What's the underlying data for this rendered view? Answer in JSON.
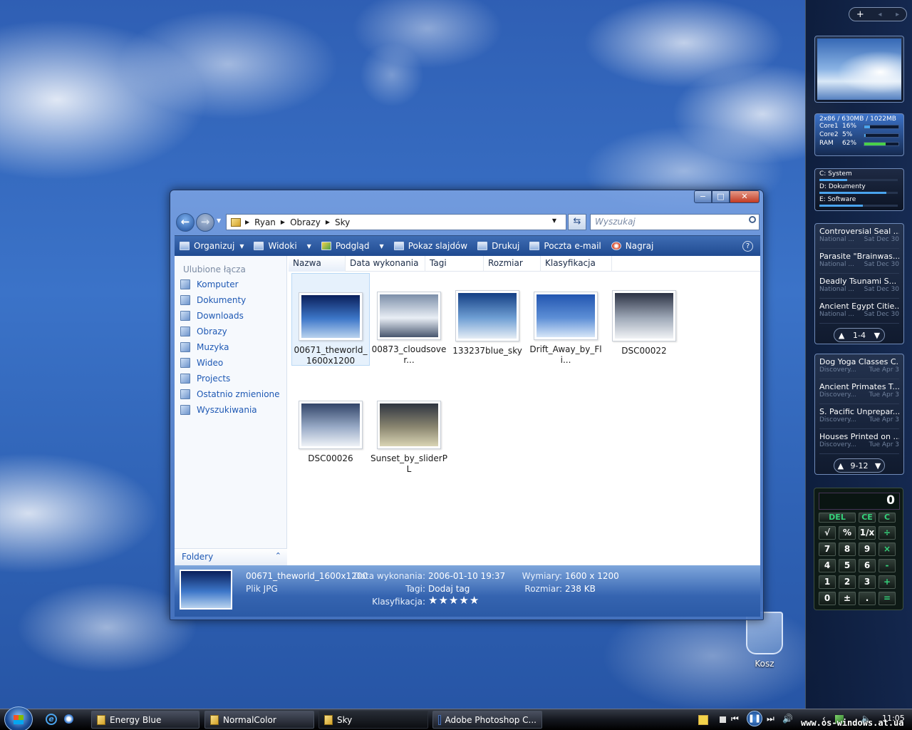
{
  "window": {
    "minimize": "−",
    "maximize": "□",
    "close": "✕"
  },
  "address": {
    "path": [
      "Ryan",
      "Obrazy",
      "Sky"
    ],
    "search_placeholder": "Wyszukaj"
  },
  "toolbar": [
    "Organizuj",
    "Widoki",
    "Podgląd",
    "Pokaz slajdów",
    "Drukuj",
    "Poczta e-mail",
    "Nagraj"
  ],
  "toolbar_help": "?",
  "nav": {
    "header": "Ulubione łącza",
    "items": [
      "Komputer",
      "Dokumenty",
      "Downloads",
      "Obrazy",
      "Muzyka",
      "Wideo",
      "Projects",
      "Ostatnio zmienione",
      "Wyszukiwania"
    ],
    "folders": "Foldery"
  },
  "columns": [
    "Nazwa",
    "Data wykonania",
    "Tagi",
    "Rozmiar",
    "Klasyfikacja"
  ],
  "files": [
    {
      "name": "00671_theworld_1600x1200",
      "colors": [
        "#0a1f5a",
        "#3d77c9",
        "#b9d3ee"
      ]
    },
    {
      "name": "00873_cloudsover...",
      "colors": [
        "#7c8fa9",
        "#e9eef5",
        "#47566f"
      ]
    },
    {
      "name": "133237blue_sky",
      "colors": [
        "#143f84",
        "#6f9fd4",
        "#e5edf5"
      ]
    },
    {
      "name": "Drift_Away_by_Fli...",
      "colors": [
        "#2255b0",
        "#5d8fd6",
        "#d6e6f8"
      ]
    },
    {
      "name": "DSC00022",
      "colors": [
        "#2c3244",
        "#9fa9b8",
        "#f1f3f6"
      ]
    },
    {
      "name": "DSC00026",
      "colors": [
        "#314468",
        "#98aac6",
        "#eef2f7"
      ]
    },
    {
      "name": "Sunset_by_sliderPL",
      "colors": [
        "#2e3440",
        "#8a8670",
        "#d9d4b4"
      ]
    }
  ],
  "details": {
    "name": "00671_theworld_1600x1200",
    "type": "Plik JPG",
    "date_label": "Data wykonania:",
    "date": "2006-01-10 19:37",
    "tags_label": "Tagi:",
    "tags": "Dodaj tag",
    "rating_label": "Klasyfikacja:",
    "dims_label": "Wymiary:",
    "dims": "1600 x 1200",
    "size_label": "Rozmiar:",
    "size": "238 KB",
    "rating_stars": 5
  },
  "sidebar": {
    "controls": [
      "+",
      "◂",
      "▸"
    ],
    "cpu": {
      "header": "2x86 / 630MB / 1022MB",
      "rows": [
        {
          "label": "Core1",
          "value": "16%",
          "level": 0.16
        },
        {
          "label": "Core2",
          "value": "5%",
          "level": 0.05
        },
        {
          "label": "RAM",
          "value": "62%",
          "level": 0.62
        }
      ]
    },
    "drives": [
      {
        "label": "C: System",
        "level": 0.35
      },
      {
        "label": "D: Dokumenty",
        "level": 0.85
      },
      {
        "label": "E: Software",
        "level": 0.55
      }
    ],
    "feed1": {
      "items": [
        {
          "title": "Controversial Seal ...",
          "source": "National ...",
          "date": "Sat Dec 30"
        },
        {
          "title": "Parasite \"Brainwas...",
          "source": "National ...",
          "date": "Sat Dec 30"
        },
        {
          "title": "Deadly Tsunami S...",
          "source": "National ...",
          "date": "Sat Dec 30"
        },
        {
          "title": "Ancient Egypt Citie...",
          "source": "National ...",
          "date": "Sat Dec 30"
        }
      ],
      "pager": "1-4"
    },
    "feed2": {
      "items": [
        {
          "title": "Dog Yoga Classes C...",
          "source": "Discovery...",
          "date": "Tue Apr 3"
        },
        {
          "title": "Ancient Primates T...",
          "source": "Discovery...",
          "date": "Tue Apr 3"
        },
        {
          "title": "S. Pacific Unprepar...",
          "source": "Discovery...",
          "date": "Tue Apr 3"
        },
        {
          "title": "Houses Printed on ...",
          "source": "Discovery...",
          "date": "Tue Apr 3"
        }
      ],
      "pager": "9-12"
    },
    "calc": {
      "display": "0",
      "keys": [
        "DEL",
        "CE",
        "C",
        "√",
        "%",
        "1/x",
        "÷",
        "7",
        "8",
        "9",
        "×",
        "4",
        "5",
        "6",
        "-",
        "1",
        "2",
        "3",
        "+",
        "0",
        "±",
        ".",
        "="
      ]
    }
  },
  "desktop": {
    "recycle": "Kosz"
  },
  "taskbar": {
    "buttons": [
      "Energy Blue",
      "NormalColor",
      "Sky",
      "Adobe Photoshop C..."
    ],
    "clock": "11:05",
    "watermark": "www.os-windows.at.ua"
  }
}
